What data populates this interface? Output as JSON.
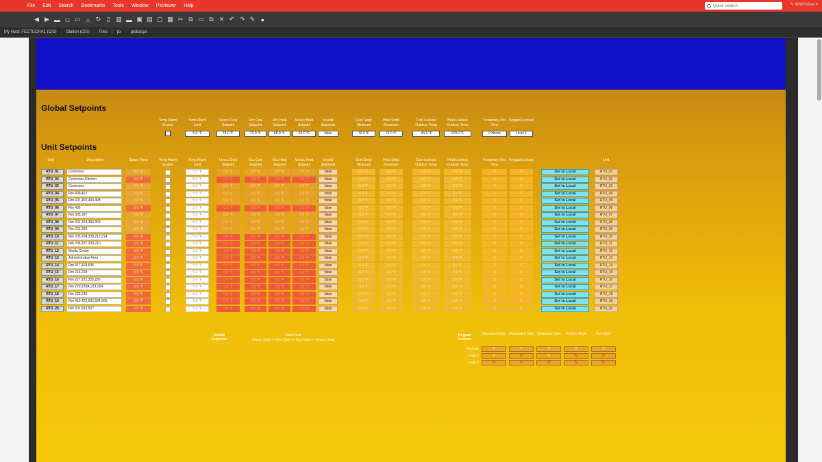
{
  "menubar": {
    "items": [
      "File",
      "Edit",
      "Search",
      "Bookmarks",
      "Tools",
      "Window",
      "PxViewer",
      "Help"
    ],
    "search_placeholder": "Quick Search"
  },
  "toolbar": {
    "icons": [
      "back-icon",
      "forward-icon",
      "folder-icon",
      "new-window-icon",
      "open-icon",
      "home-icon",
      "refresh-icon",
      "doc-icon",
      "layout-icon",
      "folder-dropdown-icon",
      "save-icon",
      "save-all-icon",
      "copy-doc-icon",
      "paste-doc-icon",
      "cut-icon",
      "copy-icon",
      "paste-icon",
      "duplicate-icon",
      "delete-icon",
      "undo-icon",
      "redo-icon",
      "edit-icon",
      "globe-icon"
    ]
  },
  "pathbar": {
    "crumbs": [
      "My Host: FECTECRA1 (CIS)",
      "Station (CIS)",
      "Files",
      "px",
      "global.px"
    ],
    "view": "WbPxView"
  },
  "global": {
    "title": "Global Setpoints",
    "headers": [
      "Temp Alarm Enable",
      "Temp Alarm Limit",
      "Unocc Cool Setpoint",
      "Occ Cool Setpoint",
      "Occ Heat Setpoint",
      "Unocc Heat Setpoint",
      "Invalid Setpoints",
      "Cool Setpt Minimum",
      "Heat Setpt Maximum",
      "Cool Lockout Outdoor Temp",
      "Heat Lockout Outdoor Temp",
      "Temporary Occ Time",
      "Keypad Lockout"
    ],
    "values": [
      "",
      "5.0 °F",
      "74.0 °F",
      "73.0 °F",
      "68.0 °F",
      "65.0 °F",
      "false",
      "70.0 °F",
      "74.0 °F",
      "-40.0 °F",
      "120.0 °F",
      "0 Hours",
      "Level 1"
    ]
  },
  "units": {
    "title": "Unit Setpoints",
    "headers": [
      "Unit",
      "Description",
      "Space Temp",
      "Temp Alarm Enable",
      "Temp Alarm Limit",
      "Unocc Cool Setpoint",
      "Occ Cool Setpoint",
      "Occ Heat Setpoint",
      "Unocc Heat Setpoint",
      "Invalid Setpoints",
      "Cool Setpt Minimum",
      "Heat Setpt Maximum",
      "Cool Lockout Outdoor Temp",
      "Heat Lockout Outdoor Temp",
      "Temporary Occ Time",
      "Keypad Lockout",
      "Unit"
    ],
    "button_label": "Set to Local",
    "rows": [
      {
        "unit": "RTU_01",
        "desc": "Commons",
        "temp": "0.0 °F",
        "limit": "5.0 °F",
        "sp": [
          "0.0 °F",
          "0.0 °F",
          "0.0 °F",
          "0.0 °F"
        ],
        "invalid": "false",
        "mm": [
          "0.0 °F",
          "0.0 °F"
        ],
        "lock": [
          "0.0 °F",
          "0.0 °F"
        ],
        "occ": "0",
        "kp": "0",
        "bad": false
      },
      {
        "unit": "RTU_02",
        "desc": "Commons,Kitchen",
        "temp": "0.0 °F",
        "limit": "5.0 °F",
        "sp": [
          "0.0 °F",
          "0.0 °F",
          "0.0 °F",
          "0.0 °F"
        ],
        "invalid": "false",
        "mm": [
          "0.0 °F",
          "0.0 °F"
        ],
        "lock": [
          "0.0 °F",
          "0.0 °F"
        ],
        "occ": "0",
        "kp": "0",
        "bad": true
      },
      {
        "unit": "RTU_03",
        "desc": "Commons",
        "temp": "0.0 °F",
        "limit": "5.0 °F",
        "sp": [
          "0.0 °F",
          "0.0 °F",
          "0.0 °F",
          "0.0 °F"
        ],
        "invalid": "false",
        "mm": [
          "0.0 °F",
          "0.0 °F"
        ],
        "lock": [
          "0.0 °F",
          "0.0 °F"
        ],
        "occ": "0",
        "kp": "0",
        "bad": false
      },
      {
        "unit": "RTU_04",
        "desc": "Rm 409,412",
        "temp": "0.0 °F",
        "limit": "5.0 °F",
        "sp": [
          "0.0 °F",
          "0.0 °F",
          "0.0 °F",
          "0.0 °F"
        ],
        "invalid": "false",
        "mm": [
          "0.0 °F",
          "0.0 °F"
        ],
        "lock": [
          "0.0 °F",
          "0.0 °F"
        ],
        "occ": "0",
        "kp": "0",
        "bad": false
      },
      {
        "unit": "RTU_05",
        "desc": "Rm 401,403,404,408",
        "temp": "0.0 °F",
        "limit": "5.0 °F",
        "sp": [
          "0.0 °F",
          "0.0 °F",
          "0.0 °F",
          "0.0 °F"
        ],
        "invalid": "false",
        "mm": [
          "0.0 °F",
          "0.0 °F"
        ],
        "lock": [
          "0.0 °F",
          "0.0 °F"
        ],
        "occ": "0",
        "kp": "0",
        "bad": false
      },
      {
        "unit": "RTU_06",
        "desc": "Rm 406",
        "temp": "0.0 °F",
        "limit": "5.0 °F",
        "sp": [
          "0.0 °F",
          "0.0 °F",
          "0.0 °F",
          "0.0 °F"
        ],
        "invalid": "false",
        "mm": [
          "0.0 °F",
          "0.0 °F"
        ],
        "lock": [
          "0.0 °F",
          "0.0 °F"
        ],
        "occ": "0",
        "kp": "0",
        "bad": true
      },
      {
        "unit": "RTU_07",
        "desc": "Rm 305,307",
        "temp": "0.0 °F",
        "limit": "5.0 °F",
        "sp": [
          "0.0 °F",
          "0.0 °F",
          "0.0 °F",
          "0.0 °F"
        ],
        "invalid": "false",
        "mm": [
          "0.0 °F",
          "0.0 °F"
        ],
        "lock": [
          "0.0 °F",
          "0.0 °F"
        ],
        "occ": "0",
        "kp": "0",
        "bad": false
      },
      {
        "unit": "RTU_08",
        "desc": "Rm 301,303,306,309",
        "temp": "0.0 °F",
        "limit": "5.0 °F",
        "sp": [
          "0.0 °F",
          "0.0 °F",
          "0.0 °F",
          "0.0 °F"
        ],
        "invalid": "false",
        "mm": [
          "0.0 °F",
          "0.0 °F"
        ],
        "lock": [
          "0.0 °F",
          "0.0 °F"
        ],
        "occ": "0",
        "kp": "0",
        "bad": false
      },
      {
        "unit": "RTU_09",
        "desc": "Rm 201,202",
        "temp": "0.0 °F",
        "limit": "5.0 °F",
        "sp": [
          "0.0 °F",
          "0.0 °F",
          "0.0 °F",
          "0.0 °F"
        ],
        "invalid": "false",
        "mm": [
          "0.0 °F",
          "0.0 °F"
        ],
        "lock": [
          "0.0 °F",
          "0.0 °F"
        ],
        "occ": "0",
        "kp": "0",
        "bad": false
      },
      {
        "unit": "RTU_10",
        "desc": "Rm 203,204,208,212,214",
        "temp": "0.0 °F",
        "limit": "5.0 °F",
        "sp": [
          "0.0 °F",
          "0.0 °F",
          "0.0 °F",
          "0.0 °F"
        ],
        "invalid": "false",
        "mm": [
          "0.0 °F",
          "0.0 °F"
        ],
        "lock": [
          "0.0 °F",
          "0.0 °F"
        ],
        "occ": "0",
        "kp": "0",
        "bad": true
      },
      {
        "unit": "RTU_11",
        "desc": "Rm 205,207,209,210",
        "temp": "0.0 °F",
        "limit": "5.0 °F",
        "sp": [
          "0.0 °F",
          "0.0 °F",
          "0.0 °F",
          "0.0 °F"
        ],
        "invalid": "false",
        "mm": [
          "0.0 °F",
          "0.0 °F"
        ],
        "lock": [
          "0.0 °F",
          "0.0 °F"
        ],
        "occ": "0",
        "kp": "0",
        "bad": true
      },
      {
        "unit": "RTU_12",
        "desc": "Media Center",
        "temp": "0.0 °F",
        "limit": "5.0 °F",
        "sp": [
          "0.0 °F",
          "0.0 °F",
          "0.0 °F",
          "0.0 °F"
        ],
        "invalid": "false",
        "mm": [
          "0.0 °F",
          "0.0 °F"
        ],
        "lock": [
          "0.0 °F",
          "0.0 °F"
        ],
        "occ": "0",
        "kp": "0",
        "bad": true
      },
      {
        "unit": "RTU_13",
        "desc": "Administrative Area",
        "temp": "0.0 °F",
        "limit": "5.0 °F",
        "sp": [
          "0.0 °F",
          "0.0 °F",
          "0.0 °F",
          "0.0 °F"
        ],
        "invalid": "false",
        "mm": [
          "0.0 °F",
          "0.0 °F"
        ],
        "lock": [
          "0.0 °F",
          "0.0 °F"
        ],
        "occ": "0",
        "kp": "0",
        "bad": true
      },
      {
        "unit": "RTU_14",
        "desc": "Rm 417,418,606",
        "temp": "0.0 °F",
        "limit": "5.0 °F",
        "sp": [
          "0.0 °F",
          "0.0 °F",
          "0.0 °F",
          "0.0 °F"
        ],
        "invalid": "false",
        "mm": [
          "0.0 °F",
          "0.0 °F"
        ],
        "lock": [
          "0.0 °F",
          "0.0 °F"
        ],
        "occ": "0",
        "kp": "0",
        "bad": true
      },
      {
        "unit": "RTU_15",
        "desc": "Rm 216,218",
        "temp": "0.0 °F",
        "limit": "5.0 °F",
        "sp": [
          "0.0 °F",
          "0.0 °F",
          "0.0 °F",
          "0.0 °F"
        ],
        "invalid": "false",
        "mm": [
          "0.0 °F",
          "0.0 °F"
        ],
        "lock": [
          "0.0 °F",
          "0.0 °F"
        ],
        "occ": "0",
        "kp": "0",
        "bad": true
      },
      {
        "unit": "RTU_16",
        "desc": "Rm 217,222,225,226",
        "temp": "0.0 °F",
        "limit": "5.0 °F",
        "sp": [
          "0.0 °F",
          "0.0 °F",
          "0.0 °F",
          "0.0 °F"
        ],
        "invalid": "false",
        "mm": [
          "0.0 °F",
          "0.0 °F"
        ],
        "lock": [
          "0.0 °F",
          "0.0 °F"
        ],
        "occ": "0",
        "kp": "0",
        "bad": true
      },
      {
        "unit": "RTU_17",
        "desc": "Rm 220,220A,223,224",
        "temp": "0.0 °F",
        "limit": "5.0 °F",
        "sp": [
          "0.0 °F",
          "0.0 °F",
          "0.0 °F",
          "0.0 °F"
        ],
        "invalid": "false",
        "mm": [
          "0.0 °F",
          "0.0 °F"
        ],
        "lock": [
          "0.0 °F",
          "0.0 °F"
        ],
        "occ": "0",
        "kp": "0",
        "bad": true
      },
      {
        "unit": "RTU_18",
        "desc": "Rm 229,230",
        "temp": "0.0 °F",
        "limit": "5.0 °F",
        "sp": [
          "0.0 °F",
          "0.0 °F",
          "0.0 °F",
          "0.0 °F"
        ],
        "invalid": "false",
        "mm": [
          "0.0 °F",
          "0.0 °F"
        ],
        "lock": [
          "0.0 °F",
          "0.0 °F"
        ],
        "occ": "0",
        "kp": "0",
        "bad": true
      },
      {
        "unit": "RTU_19",
        "desc": "Rm 419,420,502,504,506",
        "temp": "0.0 °F",
        "limit": "5.0 °F",
        "sp": [
          "0.0 °F",
          "0.0 °F",
          "0.0 °F",
          "0.0 °F"
        ],
        "invalid": "false",
        "mm": [
          "0.0 °F",
          "0.0 °F"
        ],
        "lock": [
          "0.0 °F",
          "0.0 °F"
        ],
        "occ": "0",
        "kp": "0",
        "bad": true
      },
      {
        "unit": "RTU_20",
        "desc": "Rm 501,503,507",
        "temp": "0.0 °F",
        "limit": "5.0 °F",
        "sp": [
          "0.0 °F",
          "0.0 °F",
          "0.0 °F",
          "0.0 °F"
        ],
        "invalid": "false",
        "mm": [
          "0.0 °F",
          "0.0 °F"
        ],
        "lock": [
          "0.0 °F",
          "0.0 °F"
        ],
        "occ": "0",
        "kp": "0",
        "bad": true
      }
    ]
  },
  "notes": {
    "invalid_label": "Invalid Setpoints",
    "musthave_title": "Must have",
    "musthave_rule": "Unocc Cool >= Occ Cool >= Occ Heat >= Unocc Heat"
  },
  "keypad_legend": {
    "title": "Keypad Lockout",
    "columns": [
      "Occupied Ovde",
      "Permanent Spts",
      "Temporary Spts",
      "System Mode",
      "Fan Mode"
    ],
    "rows": [
      {
        "label": "No Lock",
        "vals": [
          "Y",
          "Y",
          "Y",
          "Y",
          "Y"
        ]
      },
      {
        "label": "Level 1",
        "vals": [
          "Y",
          "N",
          "Y",
          "N",
          "N"
        ]
      },
      {
        "label": "Level 2",
        "vals": [
          "N",
          "N",
          "N",
          "N",
          "N"
        ]
      }
    ],
    "colors": {
      "yes": "#ffffff",
      "no": "#e0201a"
    }
  }
}
